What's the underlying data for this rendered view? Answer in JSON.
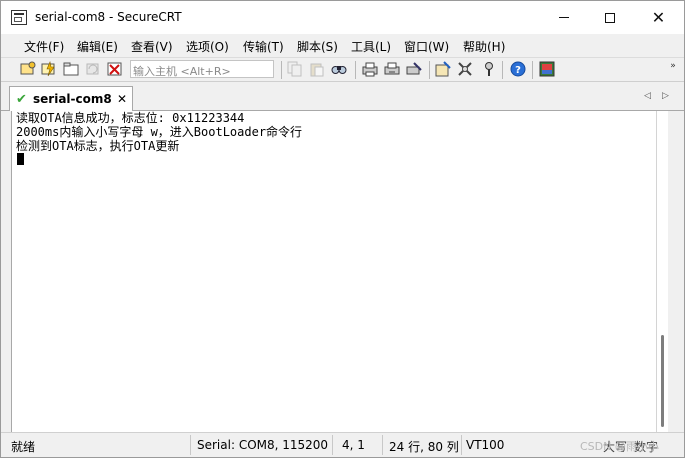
{
  "window": {
    "title": "serial-com8 - SecureCRT",
    "controls": {
      "minimize": "",
      "maximize": "",
      "close": "✕"
    }
  },
  "menu": [
    "文件(F)",
    "编辑(E)",
    "查看(V)",
    "选项(O)",
    "传输(T)",
    "脚本(S)",
    "工具(L)",
    "窗口(W)",
    "帮助(H)"
  ],
  "toolbar": {
    "quick_connect_text": "输入主机 <Alt+R>",
    "icons": [
      "connect-icon",
      "quick-connect-icon",
      "connect-tab-icon",
      "reconnect-icon",
      "disconnect-icon",
      "copy-icon",
      "paste-icon",
      "find-icon",
      "print-icon",
      "print-selection-icon",
      "print-setup-icon",
      "session-options-icon",
      "global-options-icon",
      "keymap-icon",
      "help-icon",
      "about-icon"
    ],
    "overflow": "»"
  },
  "tabs": {
    "active": {
      "check": "✔",
      "label": "serial-com8",
      "close": "✕"
    },
    "nav_left": "◁",
    "nav_right": "▷"
  },
  "terminal": {
    "lines": [
      "读取OTA信息成功，标志位: 0x11223344",
      "2000ms内输入小写字母 w，进入BootLoader命令行",
      "检测到OTA标志，执行OTA更新"
    ]
  },
  "status": {
    "ready": "就绪",
    "connection": "Serial: COM8, 115200",
    "cursor_pos": "4,   1",
    "size": "24 行, 80 列",
    "emulation": "VT100",
    "caps": "大写",
    "num": "数字"
  },
  "watermark": "CSDN @雨小小"
}
